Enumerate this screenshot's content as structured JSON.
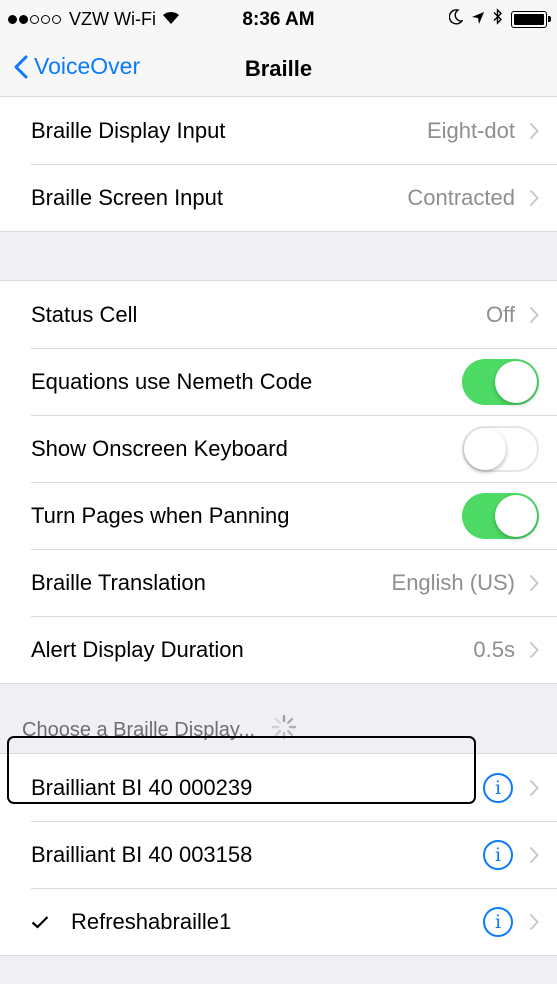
{
  "status_bar": {
    "carrier": "VZW Wi-Fi",
    "time": "8:36 AM",
    "signal_bars_filled": 2,
    "signal_bars_total": 5
  },
  "nav": {
    "back_label": "VoiceOver",
    "title": "Braille"
  },
  "input_group": [
    {
      "label": "Braille Display Input",
      "value": "Eight-dot"
    },
    {
      "label": "Braille Screen Input",
      "value": "Contracted"
    }
  ],
  "settings": {
    "status_cell": {
      "label": "Status Cell",
      "value": "Off"
    },
    "nemeth": {
      "label": "Equations use Nemeth Code",
      "on": true
    },
    "onscreen_keyboard": {
      "label": "Show Onscreen Keyboard",
      "on": false
    },
    "turn_pages": {
      "label": "Turn Pages when Panning",
      "on": true
    },
    "translation": {
      "label": "Braille Translation",
      "value": "English (US)"
    },
    "alert_duration": {
      "label": "Alert Display Duration",
      "value": "0.5s"
    }
  },
  "displays": {
    "header": "Choose a Braille Display...",
    "items": [
      {
        "label": "Brailliant BI 40 000239",
        "selected": false
      },
      {
        "label": "Brailliant BI 40 003158",
        "selected": false
      },
      {
        "label": "Refreshabraille1",
        "selected": true
      }
    ]
  },
  "colors": {
    "accent": "#0a7aff",
    "toggle_on": "#4cd964",
    "secondary_text": "#8e8e93",
    "background": "#efeff4"
  }
}
